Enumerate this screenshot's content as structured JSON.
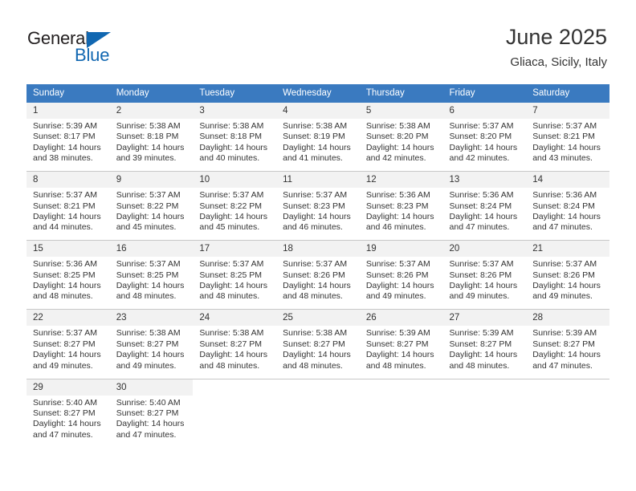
{
  "brand": {
    "word_one": "General",
    "word_two": "Blue"
  },
  "header": {
    "title": "June 2025",
    "location": "Gliaca, Sicily, Italy"
  },
  "calendar": {
    "weekday_headers": [
      "Sunday",
      "Monday",
      "Tuesday",
      "Wednesday",
      "Thursday",
      "Friday",
      "Saturday"
    ],
    "accent_color": "#3a7ac0",
    "daynum_background": "#f2f2f2",
    "weeks": [
      [
        {
          "day": "1",
          "sunrise": "Sunrise: 5:39 AM",
          "sunset": "Sunset: 8:17 PM",
          "daylight_1": "Daylight: 14 hours",
          "daylight_2": "and 38 minutes."
        },
        {
          "day": "2",
          "sunrise": "Sunrise: 5:38 AM",
          "sunset": "Sunset: 8:18 PM",
          "daylight_1": "Daylight: 14 hours",
          "daylight_2": "and 39 minutes."
        },
        {
          "day": "3",
          "sunrise": "Sunrise: 5:38 AM",
          "sunset": "Sunset: 8:18 PM",
          "daylight_1": "Daylight: 14 hours",
          "daylight_2": "and 40 minutes."
        },
        {
          "day": "4",
          "sunrise": "Sunrise: 5:38 AM",
          "sunset": "Sunset: 8:19 PM",
          "daylight_1": "Daylight: 14 hours",
          "daylight_2": "and 41 minutes."
        },
        {
          "day": "5",
          "sunrise": "Sunrise: 5:38 AM",
          "sunset": "Sunset: 8:20 PM",
          "daylight_1": "Daylight: 14 hours",
          "daylight_2": "and 42 minutes."
        },
        {
          "day": "6",
          "sunrise": "Sunrise: 5:37 AM",
          "sunset": "Sunset: 8:20 PM",
          "daylight_1": "Daylight: 14 hours",
          "daylight_2": "and 42 minutes."
        },
        {
          "day": "7",
          "sunrise": "Sunrise: 5:37 AM",
          "sunset": "Sunset: 8:21 PM",
          "daylight_1": "Daylight: 14 hours",
          "daylight_2": "and 43 minutes."
        }
      ],
      [
        {
          "day": "8",
          "sunrise": "Sunrise: 5:37 AM",
          "sunset": "Sunset: 8:21 PM",
          "daylight_1": "Daylight: 14 hours",
          "daylight_2": "and 44 minutes."
        },
        {
          "day": "9",
          "sunrise": "Sunrise: 5:37 AM",
          "sunset": "Sunset: 8:22 PM",
          "daylight_1": "Daylight: 14 hours",
          "daylight_2": "and 45 minutes."
        },
        {
          "day": "10",
          "sunrise": "Sunrise: 5:37 AM",
          "sunset": "Sunset: 8:22 PM",
          "daylight_1": "Daylight: 14 hours",
          "daylight_2": "and 45 minutes."
        },
        {
          "day": "11",
          "sunrise": "Sunrise: 5:37 AM",
          "sunset": "Sunset: 8:23 PM",
          "daylight_1": "Daylight: 14 hours",
          "daylight_2": "and 46 minutes."
        },
        {
          "day": "12",
          "sunrise": "Sunrise: 5:36 AM",
          "sunset": "Sunset: 8:23 PM",
          "daylight_1": "Daylight: 14 hours",
          "daylight_2": "and 46 minutes."
        },
        {
          "day": "13",
          "sunrise": "Sunrise: 5:36 AM",
          "sunset": "Sunset: 8:24 PM",
          "daylight_1": "Daylight: 14 hours",
          "daylight_2": "and 47 minutes."
        },
        {
          "day": "14",
          "sunrise": "Sunrise: 5:36 AM",
          "sunset": "Sunset: 8:24 PM",
          "daylight_1": "Daylight: 14 hours",
          "daylight_2": "and 47 minutes."
        }
      ],
      [
        {
          "day": "15",
          "sunrise": "Sunrise: 5:36 AM",
          "sunset": "Sunset: 8:25 PM",
          "daylight_1": "Daylight: 14 hours",
          "daylight_2": "and 48 minutes."
        },
        {
          "day": "16",
          "sunrise": "Sunrise: 5:37 AM",
          "sunset": "Sunset: 8:25 PM",
          "daylight_1": "Daylight: 14 hours",
          "daylight_2": "and 48 minutes."
        },
        {
          "day": "17",
          "sunrise": "Sunrise: 5:37 AM",
          "sunset": "Sunset: 8:25 PM",
          "daylight_1": "Daylight: 14 hours",
          "daylight_2": "and 48 minutes."
        },
        {
          "day": "18",
          "sunrise": "Sunrise: 5:37 AM",
          "sunset": "Sunset: 8:26 PM",
          "daylight_1": "Daylight: 14 hours",
          "daylight_2": "and 48 minutes."
        },
        {
          "day": "19",
          "sunrise": "Sunrise: 5:37 AM",
          "sunset": "Sunset: 8:26 PM",
          "daylight_1": "Daylight: 14 hours",
          "daylight_2": "and 49 minutes."
        },
        {
          "day": "20",
          "sunrise": "Sunrise: 5:37 AM",
          "sunset": "Sunset: 8:26 PM",
          "daylight_1": "Daylight: 14 hours",
          "daylight_2": "and 49 minutes."
        },
        {
          "day": "21",
          "sunrise": "Sunrise: 5:37 AM",
          "sunset": "Sunset: 8:26 PM",
          "daylight_1": "Daylight: 14 hours",
          "daylight_2": "and 49 minutes."
        }
      ],
      [
        {
          "day": "22",
          "sunrise": "Sunrise: 5:37 AM",
          "sunset": "Sunset: 8:27 PM",
          "daylight_1": "Daylight: 14 hours",
          "daylight_2": "and 49 minutes."
        },
        {
          "day": "23",
          "sunrise": "Sunrise: 5:38 AM",
          "sunset": "Sunset: 8:27 PM",
          "daylight_1": "Daylight: 14 hours",
          "daylight_2": "and 49 minutes."
        },
        {
          "day": "24",
          "sunrise": "Sunrise: 5:38 AM",
          "sunset": "Sunset: 8:27 PM",
          "daylight_1": "Daylight: 14 hours",
          "daylight_2": "and 48 minutes."
        },
        {
          "day": "25",
          "sunrise": "Sunrise: 5:38 AM",
          "sunset": "Sunset: 8:27 PM",
          "daylight_1": "Daylight: 14 hours",
          "daylight_2": "and 48 minutes."
        },
        {
          "day": "26",
          "sunrise": "Sunrise: 5:39 AM",
          "sunset": "Sunset: 8:27 PM",
          "daylight_1": "Daylight: 14 hours",
          "daylight_2": "and 48 minutes."
        },
        {
          "day": "27",
          "sunrise": "Sunrise: 5:39 AM",
          "sunset": "Sunset: 8:27 PM",
          "daylight_1": "Daylight: 14 hours",
          "daylight_2": "and 48 minutes."
        },
        {
          "day": "28",
          "sunrise": "Sunrise: 5:39 AM",
          "sunset": "Sunset: 8:27 PM",
          "daylight_1": "Daylight: 14 hours",
          "daylight_2": "and 47 minutes."
        }
      ],
      [
        {
          "day": "29",
          "sunrise": "Sunrise: 5:40 AM",
          "sunset": "Sunset: 8:27 PM",
          "daylight_1": "Daylight: 14 hours",
          "daylight_2": "and 47 minutes."
        },
        {
          "day": "30",
          "sunrise": "Sunrise: 5:40 AM",
          "sunset": "Sunset: 8:27 PM",
          "daylight_1": "Daylight: 14 hours",
          "daylight_2": "and 47 minutes."
        },
        {
          "day": "",
          "sunrise": "",
          "sunset": "",
          "daylight_1": "",
          "daylight_2": ""
        },
        {
          "day": "",
          "sunrise": "",
          "sunset": "",
          "daylight_1": "",
          "daylight_2": ""
        },
        {
          "day": "",
          "sunrise": "",
          "sunset": "",
          "daylight_1": "",
          "daylight_2": ""
        },
        {
          "day": "",
          "sunrise": "",
          "sunset": "",
          "daylight_1": "",
          "daylight_2": ""
        },
        {
          "day": "",
          "sunrise": "",
          "sunset": "",
          "daylight_1": "",
          "daylight_2": ""
        }
      ]
    ]
  }
}
